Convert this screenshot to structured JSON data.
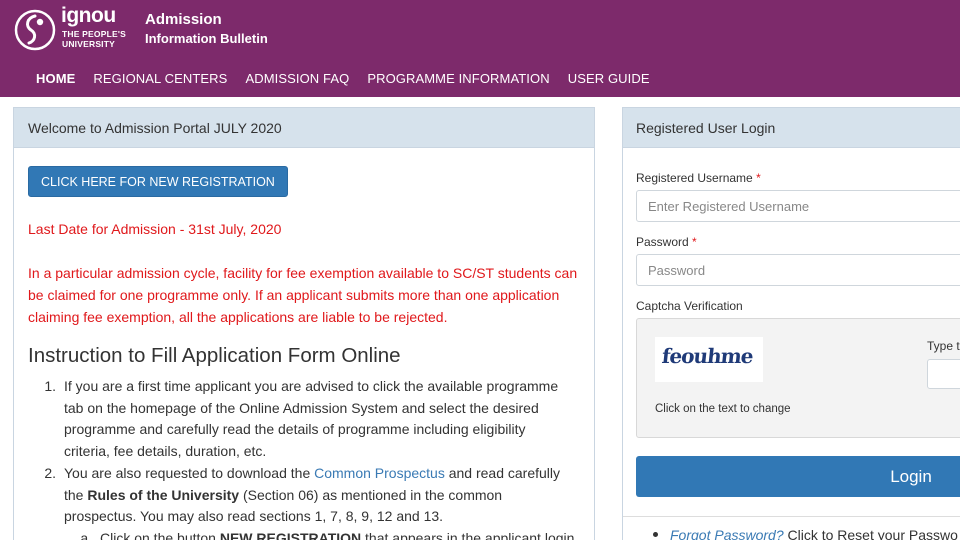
{
  "header": {
    "logo_word": "ignou",
    "logo_tag_line1": "THE PEOPLE'S",
    "logo_tag_line2": "UNIVERSITY",
    "title": "Admission",
    "subtitle": "Information Bulletin",
    "background_color": "#7d2a6b"
  },
  "nav": {
    "items": [
      {
        "label": "HOME",
        "active": true
      },
      {
        "label": "REGIONAL CENTERS"
      },
      {
        "label": "ADMISSION FAQ"
      },
      {
        "label": "PROGRAMME INFORMATION"
      },
      {
        "label": "USER GUIDE"
      }
    ]
  },
  "main": {
    "panel_title": "Welcome to Admission Portal JULY 2020",
    "new_registration_label": "CLICK HERE FOR NEW REGISTRATION",
    "last_date": "Last Date for Admission - 31st July, 2020",
    "warning": "In a particular admission cycle, facility for fee exemption available to SC/ST students can be claimed for one programme only. If an applicant submits more than one application claiming fee exemption, all the applications are liable to be rejected.",
    "instruction_title": "Instruction to Fill Application Form Online",
    "instructions": [
      {
        "num": "1.",
        "text": "If you are a first time applicant you are advised to click the available programme tab on the homepage of the Online Admission System and select the desired programme and carefully read the details of programme including eligibility criteria, fee details, duration, etc."
      },
      {
        "num": "2.",
        "text_before": "You are also requested to download the ",
        "link": "Common Prospectus",
        "text_mid": " and read carefully the ",
        "bold": "Rules of the University",
        "text_after": " (Section 06) as mentioned in the common prospectus. You may also read sections 1, 7, 8, 9, 12 and 13."
      },
      {
        "num": "a.",
        "text_before": "Click on the button ",
        "bold": "NEW REGISTRATION",
        "text_after": " that appears in the applicant login"
      }
    ],
    "accent_color": "#3178b5",
    "alert_color": "#e0181b"
  },
  "login": {
    "panel_title": "Registered User Login",
    "username_label": "Registered Username",
    "username_placeholder": "Enter Registered Username",
    "password_label": "Password",
    "password_placeholder": "Password",
    "required_marker": "*",
    "captcha_label": "Captcha Verification",
    "captcha_text": "feouhme",
    "captcha_hint": "Click on the text to change",
    "captcha_type_label": "Type th",
    "login_label": "Login",
    "forgot_link": "Forgot Password?",
    "forgot_text": " Click to Reset your Passwo"
  }
}
